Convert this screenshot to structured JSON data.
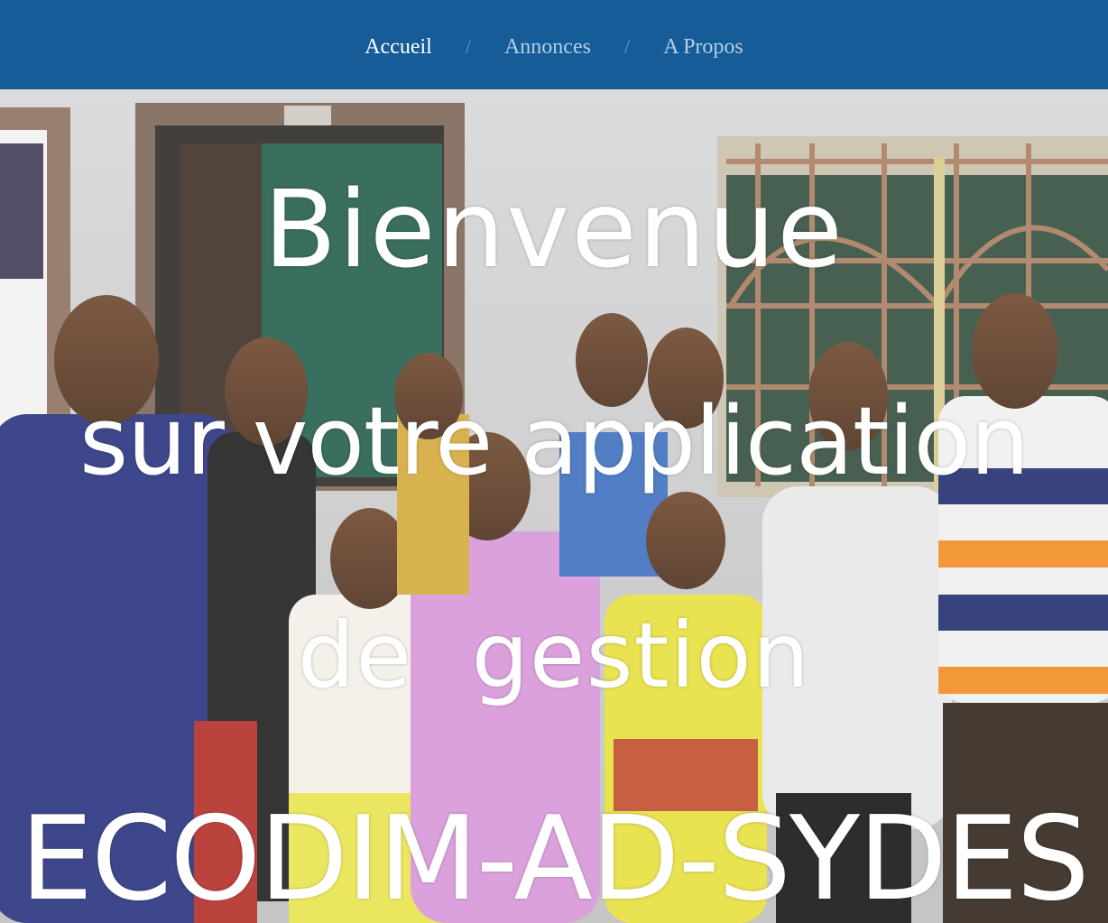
{
  "nav": {
    "items": [
      {
        "label": "Accueil",
        "active": true
      },
      {
        "label": "Annonces",
        "active": false
      },
      {
        "label": "A Propos",
        "active": false
      }
    ],
    "separator": "/"
  },
  "hero": {
    "line1": "Bienvenue",
    "line2": "sur votre application",
    "line3": "de  gestion",
    "line4": "ECODIM-AD-SYDES"
  },
  "colors": {
    "navbar": "#155c99",
    "nav_active": "#ffffff",
    "nav_inactive": "#b6cde3",
    "hero_text": "#ffffff"
  }
}
